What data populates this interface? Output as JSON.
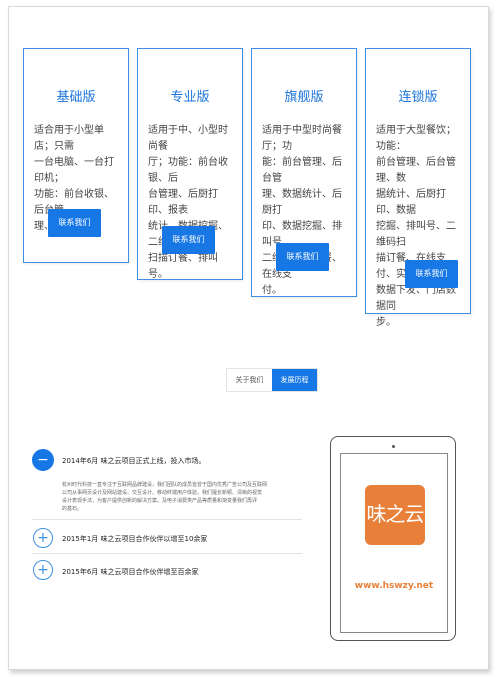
{
  "plans": [
    {
      "title": "基础版",
      "lines": [
        "适合用于小型单店；只需",
        "一台电脑、一台打印机；",
        "功能：前台收银、后台管",
        "理、后厨打印。"
      ],
      "button": "联系我们"
    },
    {
      "title": "专业版",
      "lines": [
        "适用于中、小型时尚餐",
        "厅；功能：前台收银、后",
        "台管理、后厨打印、报表",
        "统计、数据挖掘、二维码",
        "扫描订餐、排叫号。"
      ],
      "button": "联系我们"
    },
    {
      "title": "旗舰版",
      "lines": [
        "适用于中型时尚餐厅；功",
        "能：前台管理、后台管",
        "理、数据统计、后厨打",
        "印、数据挖掘、排叫号、",
        "二维码扫描订餐、在线支",
        "付。"
      ],
      "button": "联系我们"
    },
    {
      "title": "连锁版",
      "lines": [
        "适用于大型餐饮；功能：",
        "前台管理、后台管理、数",
        "据统计、后厨打印、数据",
        "挖掘、排叫号、二维码扫",
        "描订餐、在线支付、实时",
        "数据下发、门店数据同",
        "步。"
      ],
      "button": "联系我们"
    }
  ],
  "tabs": [
    "关于我们",
    "发展历程"
  ],
  "timeline": [
    {
      "icon": "−",
      "title": "2014年6月 味之云项目正式上线，投入市场。",
      "text": [
        "杭州时代科技一直专注于互联网品牌建设，我们团队的成员皆曾于国内优秀广告公司及互联网",
        "公司从事网页设计及网站建设、交互设计、移动终端用户体验，我们擅长新颖、清晰的视觉",
        "设计表现手法，为客户提供创新的解决方案。及电子消费类产品等质量和渐变量我们再评",
        "的基石。"
      ]
    },
    {
      "icon": "+",
      "title": "2015年1月 味之云项目合作伙伴以增至10余家"
    },
    {
      "icon": "+",
      "title": "2015年6月 味之云项目合作伙伴增至百余家"
    }
  ],
  "tablet": {
    "logo": "味之云",
    "url": "www.hswzy.net"
  },
  "colors": {
    "accent": "#1677e5",
    "border": "#3f8fe0",
    "logo": "#e8803a"
  }
}
